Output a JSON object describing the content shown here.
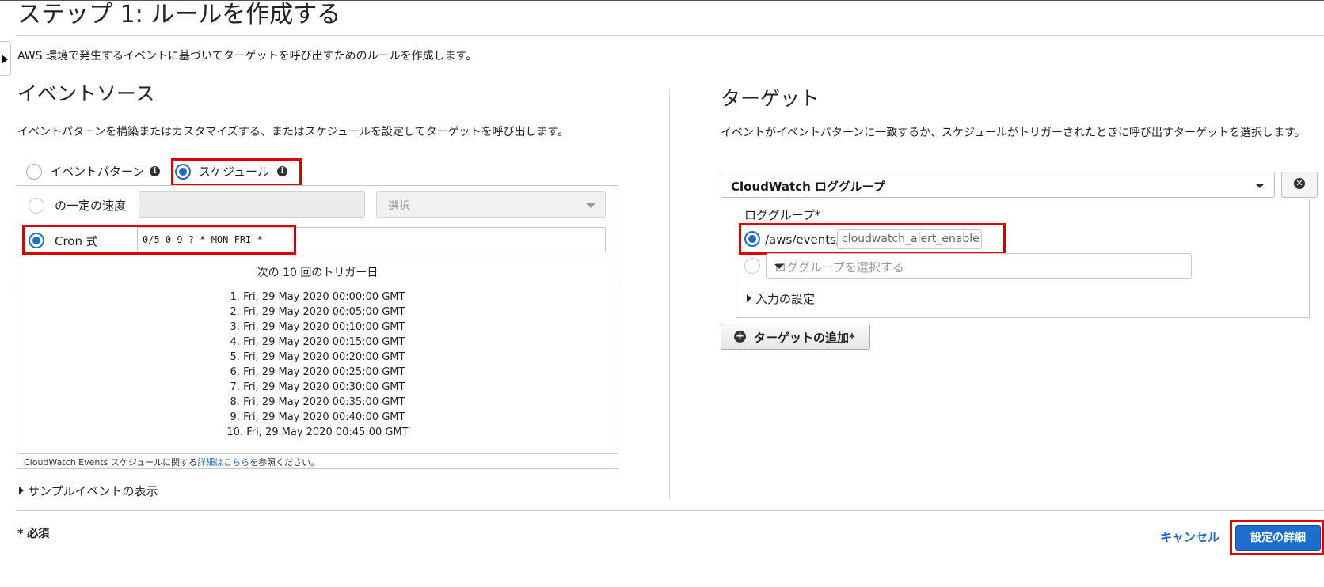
{
  "page": {
    "title": "ステップ 1: ルールを作成する",
    "description": "AWS 環境で発生するイベントに基づいてターゲットを呼び出すためのルールを作成します。"
  },
  "event_source": {
    "title": "イベントソース",
    "description": "イベントパターンを構築またはカスタマイズする、またはスケジュールを設定してターゲットを呼び出します。",
    "option_event_pattern": "イベントパターン",
    "option_schedule": "スケジュール",
    "info_glyph": "i",
    "fixed_rate_label": "の一定の速度",
    "rate_unit_placeholder": "選択",
    "cron_label": "Cron 式",
    "cron_value": "0/5 0-9 ? * MON-FRI *",
    "triggers_header": "次の 10 回のトリガー日",
    "triggers": [
      "1. Fri, 29 May 2020 00:00:00 GMT",
      "2. Fri, 29 May 2020 00:05:00 GMT",
      "3. Fri, 29 May 2020 00:10:00 GMT",
      "4. Fri, 29 May 2020 00:15:00 GMT",
      "5. Fri, 29 May 2020 00:20:00 GMT",
      "6. Fri, 29 May 2020 00:25:00 GMT",
      "7. Fri, 29 May 2020 00:30:00 GMT",
      "8. Fri, 29 May 2020 00:35:00 GMT",
      "9. Fri, 29 May 2020 00:40:00 GMT",
      "10. Fri, 29 May 2020 00:45:00 GMT"
    ],
    "note_prefix": "CloudWatch Events スケジュールに関する",
    "note_link": "詳細はこちら",
    "note_suffix": "を参照ください。",
    "sample_event_toggle": "サンプルイベントの表示"
  },
  "target": {
    "title": "ターゲット",
    "description": "イベントがイベントパターンに一致するか、スケジュールがトリガーされたときに呼び出すターゲットを選択します。",
    "type_selected": "CloudWatch ロググループ",
    "remove_glyph": "✕",
    "log_group_label": "ロググループ*",
    "log_group_prefix": "/aws/events/",
    "log_group_value": "cloudwatch_alert_enable",
    "log_group_select_placeholder": "ロググループを選択する",
    "input_settings_toggle": "入力の設定",
    "add_glyph": "+",
    "add_target_label": "ターゲットの追加*"
  },
  "footer": {
    "required_note": "* 必須",
    "cancel_label": "キャンセル",
    "next_label": "設定の詳細"
  },
  "colors": {
    "accent": "#1b6ed0",
    "highlight": "#e00000",
    "link": "#1b66c9"
  }
}
